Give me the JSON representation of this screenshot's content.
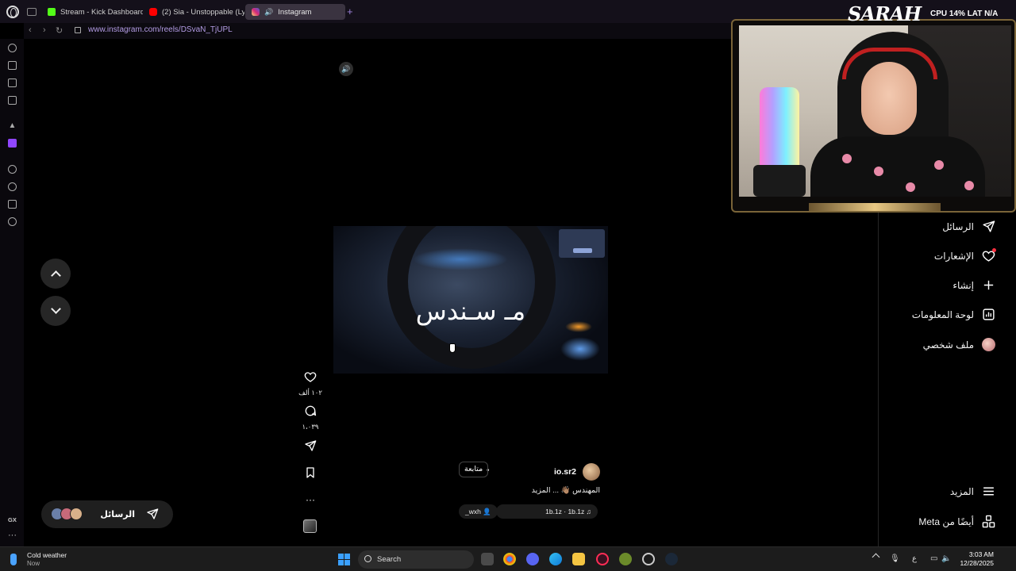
{
  "browser": {
    "tabs": [
      {
        "label": "Stream - Kick Dashboard",
        "favicon": "kick-icon"
      },
      {
        "label": "(2) Sia - Unstoppable (Ly",
        "favicon": "youtube-icon"
      },
      {
        "label": "Instagram",
        "favicon": "instagram-icon",
        "active": true
      }
    ],
    "url": "www.instagram.com/reels/DSvaN_TjUPL"
  },
  "reel": {
    "overlay_text": "مـ سـندس",
    "username": "io.sr2",
    "follow_label": "متابعة",
    "caption": "المهندس 👋🏽 ... المزيد",
    "audio": "1b.1z · 1b.1z",
    "tagged": "_wxh"
  },
  "actions": {
    "likes": "١٠٢ ألف",
    "comments": "١،٠٣٩"
  },
  "dm": {
    "label": "الرسائل"
  },
  "right_nav": {
    "messages": "الرسائل",
    "notifications": "الإشعارات",
    "create": "إنشاء",
    "dashboard": "لوحة المعلومات",
    "profile": "ملف شخصي",
    "more": "المزيد",
    "meta": "أيضًا من Meta"
  },
  "overlay": {
    "logo": "SARAH",
    "cpu": "CPU 14%",
    "lat": "LAT N/A"
  },
  "taskbar": {
    "weather_title": "Cold weather",
    "weather_sub": "Now",
    "search": "Search",
    "time": "3:03 AM",
    "date": "12/28/2025",
    "lang": "ع"
  },
  "sidebar": {
    "gx": "GX"
  },
  "colors": {
    "accent": "#9a7fd6",
    "instagram_bg": "#000000",
    "notification": "#ff3040",
    "frame_gold": "#7a6438"
  }
}
